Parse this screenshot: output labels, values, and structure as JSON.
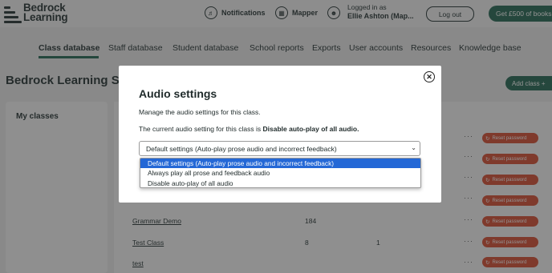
{
  "header": {
    "logo_line1": "Bedrock",
    "logo_line2": "Learning",
    "notifications_label": "Notifications",
    "mapper_label": "Mapper",
    "logged_in_as": "Logged in as",
    "user_name": "Ellie Ashton (Map...",
    "logout_label": "Log out",
    "gift_label": "Get £500 of books"
  },
  "nav": {
    "items": [
      "Class database",
      "Staff database",
      "Student database",
      "School reports",
      "Exports",
      "User accounts",
      "Resources",
      "Knowledge base"
    ],
    "active_index": 0
  },
  "page": {
    "title": "Bedrock Learning S",
    "add_class_label": "Add class +",
    "sidebar_heading": "My classes",
    "rows": [
      {
        "name": "",
        "n1": "",
        "n2": "",
        "reset": "Reset password"
      },
      {
        "name": "",
        "n1": "",
        "n2": "",
        "reset": "Reset password"
      },
      {
        "name": "",
        "n1": "",
        "n2": "",
        "reset": "Reset password"
      },
      {
        "name": "",
        "n1": "",
        "n2": "",
        "reset": "Reset password"
      },
      {
        "name": "Grammar Demo",
        "n1": "184",
        "n2": "",
        "reset": "Reset password"
      },
      {
        "name": "Test Class",
        "n1": "8",
        "n2": "1",
        "reset": "Reset password"
      },
      {
        "name": "test",
        "n1": "",
        "n2": "",
        "reset": "Reset password"
      }
    ],
    "row_dots": "···"
  },
  "modal": {
    "title": "Audio settings",
    "description": "Manage the audio settings for this class.",
    "current_prefix": "The current audio setting for this class is ",
    "current_value": "Disable auto-play of all audio.",
    "select_value": "Default settings (Auto-play prose audio and incorrect feedback)",
    "options": [
      "Default settings (Auto-play prose audio and incorrect feedback)",
      "Always play all prose and feedback audio",
      "Disable auto-play of all audio"
    ],
    "selected_option_index": 0
  },
  "colors": {
    "brand_green": "#2d6e5a",
    "reset_red": "#d9553b",
    "select_highlight": "#2468d6"
  }
}
